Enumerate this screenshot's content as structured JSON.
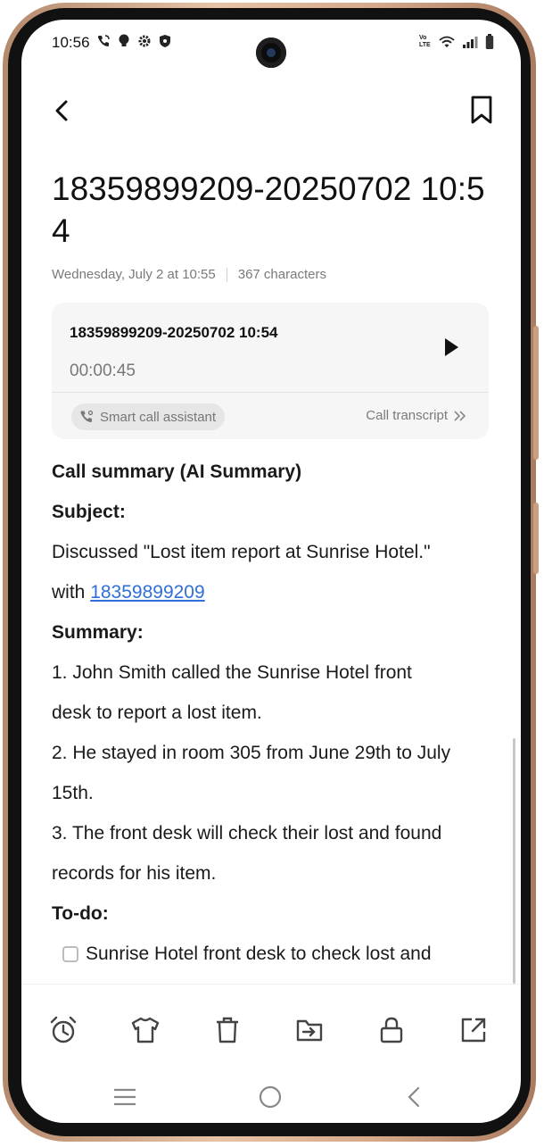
{
  "status_bar": {
    "time": "10:56",
    "left_icons": [
      "call-icon",
      "bulb-icon",
      "gear-icon",
      "shield-icon"
    ],
    "right_icons": [
      "volte-icon",
      "wifi-icon",
      "signal-icon",
      "battery-icon"
    ],
    "volte_label": "Vo LTE"
  },
  "note": {
    "title": "18359899209-20250702 10:54",
    "date": "Wednesday, July 2 at 10:55",
    "char_count": "367 characters"
  },
  "recording": {
    "title": "18359899209-20250702 10:54",
    "duration": "00:00:45",
    "assistant_label": "Smart call assistant",
    "transcript_label": "Call transcript"
  },
  "content": {
    "summary_heading": "Call summary (AI Summary)",
    "subject_heading": "Subject:",
    "subject_line1": "Discussed \"Lost item report at Sunrise Hotel.\"",
    "subject_with": "with ",
    "subject_phone": "18359899209",
    "summary_label": "Summary:",
    "summary_lines": [
      "1. John Smith called the Sunrise Hotel front",
      "desk to report a lost item.",
      "2. He stayed in room 305 from June 29th to July",
      "15th.",
      "3. The front desk will check their lost and found",
      "records for his item."
    ],
    "todo_heading": "To-do:",
    "todo_item": "Sunrise Hotel front desk to check lost and",
    "todo_checked": false
  },
  "toolbar": [
    "alarm-icon",
    "shirt-icon",
    "trash-icon",
    "move-to-folder-icon",
    "lock-icon",
    "share-icon"
  ],
  "nav": [
    "menu-icon",
    "home-icon",
    "back-icon"
  ],
  "colors": {
    "link": "#2f6fd9",
    "frame": "#d6a98a"
  }
}
